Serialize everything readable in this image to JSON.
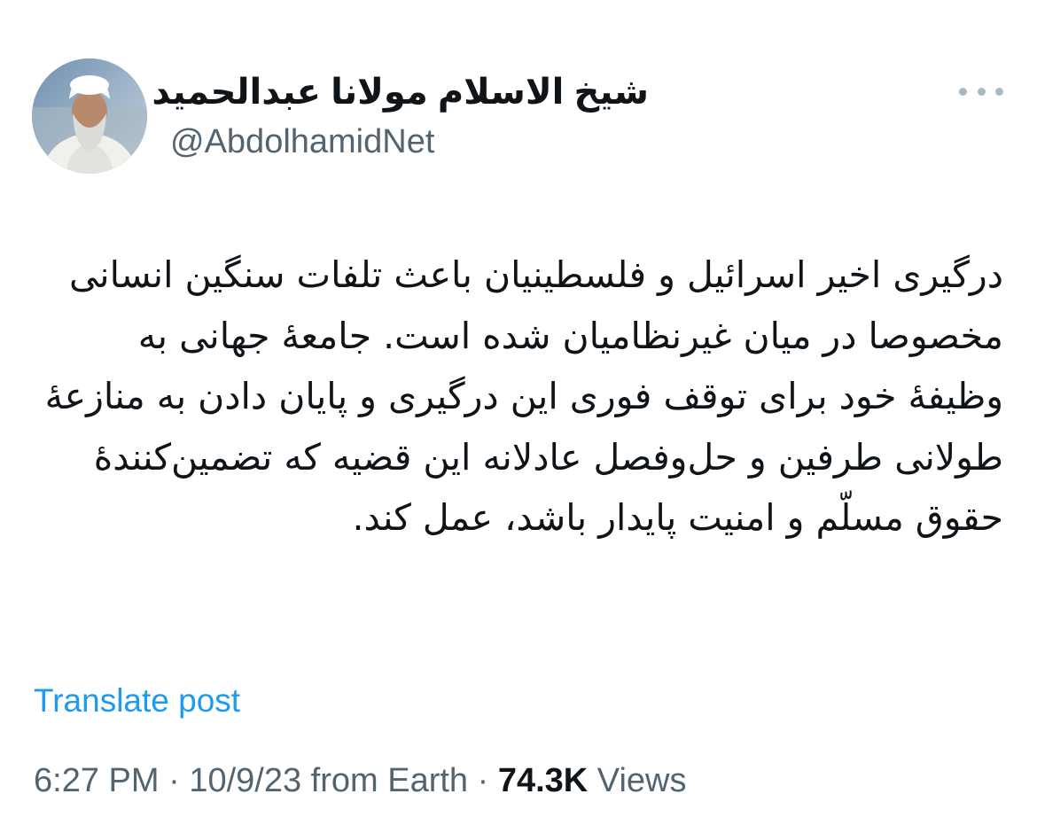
{
  "author": {
    "display_name": "شیخ الاسلام مولانا عبدالحمید",
    "handle": "@AbdolhamidNet",
    "avatar_icon": "profile-photo"
  },
  "more_icon": "more-horizontal-icon",
  "tweet": {
    "text": "درگیری اخیر اسرائیل و فلسطینیان باعث تلفات سنگین انسانی مخصوصا در میان غیرنظامیان شده است. جامعۀ جهانی به وظیفۀ خود برای توقف فوری این درگیری و پایان دادن به منازعۀ طولانی طرفین و حل‌وفصل عادلانه این قضیه که تضمین‌کنندۀ حقوق مسلّم و امنیت پایدار باشد، عمل کند.",
    "translate_label": "Translate post"
  },
  "meta": {
    "time": "6:27 PM",
    "sep1": " · ",
    "date": "10/9/23",
    "location": " from Earth",
    "sep2": " · ",
    "views_count": "74.3K",
    "views_label": " Views"
  },
  "colors": {
    "link": "#1d9bf0",
    "secondary_text": "#536471",
    "primary_text": "#0f1419"
  }
}
